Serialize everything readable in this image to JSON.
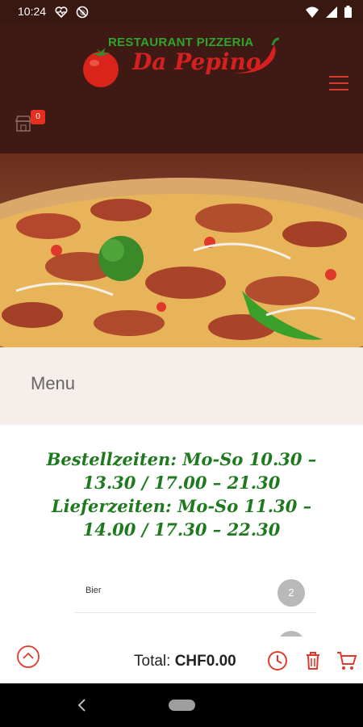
{
  "status_bar": {
    "time": "10:24"
  },
  "header": {
    "logo_top": "RESTAURANT PIZZERIA",
    "logo_script": "Da Pepino",
    "cart_badge": "0"
  },
  "menu": {
    "title": "Menu"
  },
  "hours": {
    "order_line1": "Bestellzeiten: Mo-So 10.30 –",
    "order_line2": "13.30 / 17.00 – 21.30",
    "delivery_line1": "Lieferzeiten: Mo-So 11.30 –",
    "delivery_line2": "14.00 / 17.30 – 22.30"
  },
  "categories": [
    {
      "label": "Bier",
      "count": "2"
    }
  ],
  "bottom_bar": {
    "total_label": "Total:",
    "total_value": "CHF0.00"
  },
  "colors": {
    "header_bg": "#3f1a14",
    "accent_red": "#d52020",
    "logo_green": "#2fa52c",
    "hours_green": "#1f7a1f",
    "menu_band": "#f5eeea"
  }
}
